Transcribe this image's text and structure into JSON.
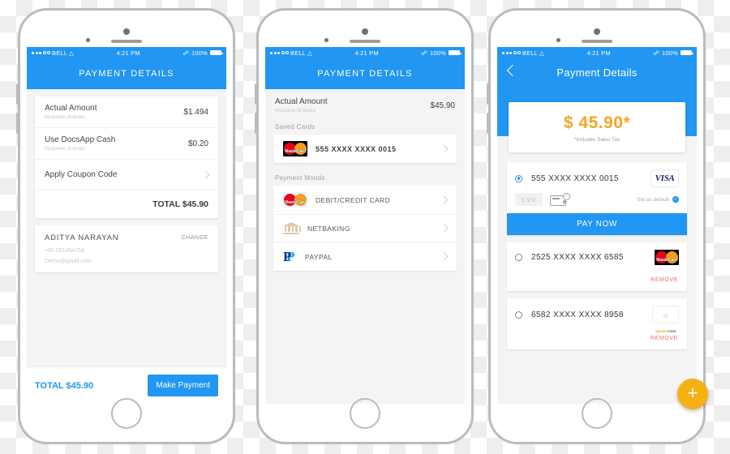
{
  "status_bar": {
    "carrier": "BELL",
    "time": "4:21 PM",
    "battery_percent": "100%"
  },
  "colors": {
    "brand_blue": "#2196f3",
    "amount_orange": "#f5a623",
    "remove_red": "#f06a6a",
    "fab_yellow": "#f5b014"
  },
  "phone1": {
    "nav_title": "PAYMENT DETAILS",
    "summary_rows": [
      {
        "title": "Actual Amount",
        "sub": "Inclusive of texes",
        "value": "$1.494"
      },
      {
        "title": "Use DocsApp Cash",
        "sub": "Inclusive of texes",
        "value": "$0.20"
      }
    ],
    "coupon_label": "Apply Coupon Code",
    "total_label": "TOTAL $45.90",
    "contact": {
      "name": "ADITYA NARAYAN",
      "change_label": "CHANGE",
      "phone": "+91 001454754",
      "email": "Demo@gmail.com"
    },
    "bottom_bar": {
      "total": "TOTAL $45.90",
      "button": "Make Payment"
    }
  },
  "phone2": {
    "nav_title": "PAYMENT DETAILS",
    "actual_amount": {
      "title": "Actual Amount",
      "sub": "Inclusive of texes",
      "value": "$45.90"
    },
    "saved_cards_label": "Saved Cards",
    "saved_cards": [
      {
        "number": "555 XXXX XXXX 0015",
        "brand": "mastercard-logo"
      }
    ],
    "payment_modes_label": "Payment Moods",
    "payment_modes": [
      {
        "label": "DEBIT/CREDIT CARD",
        "icon": "mastercard-logo"
      },
      {
        "label": "NETBAKING",
        "icon": "bank-icon"
      },
      {
        "label": "PAYPAL",
        "icon": "paypal-logo"
      }
    ]
  },
  "phone3": {
    "nav_title": "Payment Details",
    "back_icon": "back-chevron-icon",
    "amount": "$ 45.90*",
    "amount_note": "*Includes Sales Tax",
    "selected_card": {
      "number": "555 XXXX XXXX 0015",
      "brand": "visa-logo",
      "cvv_placeholder": "CVV",
      "cvv_value": "",
      "set_default_label": "Set as default",
      "pay_button": "PAY NOW"
    },
    "other_cards": [
      {
        "number": "2525 XXXX XXXX 6585",
        "brand": "mastercard-logo",
        "remove_label": "REMOVE"
      },
      {
        "number": "6582 XXXX XXXX 8958",
        "brand": "spectrocoin-logo",
        "remove_label": "REMOVE"
      }
    ],
    "spectrocoin": {
      "part1": "Spectro",
      "part2": "Coin"
    },
    "visa_text": "VISA",
    "mastercard_text": "MasterCard",
    "fab_label": "+"
  }
}
